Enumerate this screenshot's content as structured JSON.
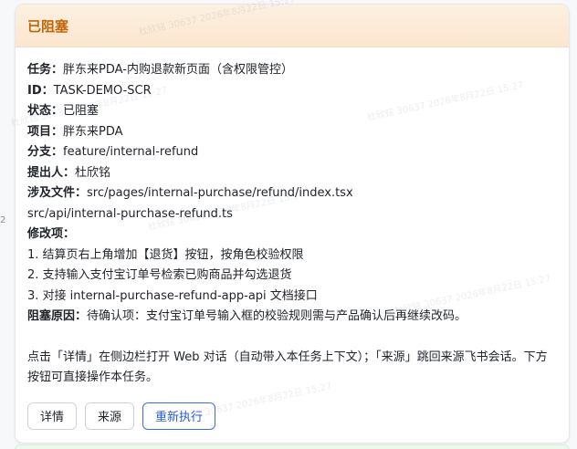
{
  "card": {
    "title": "已阻塞",
    "fields": {
      "task_label": "任务",
      "task_value": "胖东来PDA-内购退款新页面（含权限管控）",
      "id_label": "ID",
      "id_value": "TASK-DEMO-SCR",
      "status_label": "状态",
      "status_value": "已阻塞",
      "project_label": "项目",
      "project_value": "胖东来PDA",
      "branch_label": "分支",
      "branch_value": "feature/internal-refund",
      "submitter_label": "提出人",
      "submitter_value": "杜欣铭",
      "files_label": "涉及文件",
      "files": [
        "src/pages/internal-purchase/refund/index.tsx",
        "src/api/internal-purchase-refund.ts"
      ],
      "changes_label": "修改项",
      "changes": [
        "1. 结算页右上角增加【退货】按钮，按角色校验权限",
        "2. 支持输入支付宝订单号检索已购商品并勾选退货",
        "3. 对接 internal-purchase-refund-app-api 文档接口"
      ],
      "blocked_label": "阻塞原因",
      "blocked_value": "待确认项：支付宝订单号输入框的校验规则需与产品确认后再继续改码。"
    },
    "sep": "：",
    "note": "点击「详情」在侧边栏打开 Web 对话（自动带入本任务上下文）；「来源」跳回来源飞书会话。下方按钮可直接操作本任务。",
    "buttons": {
      "detail": "详情",
      "source": "来源",
      "rerun": "重新执行"
    }
  },
  "watermarks": [
    "杜欣铭 30637 2026年8月22日 15:27",
    "杜欣铭 30637 2026年8月22日 15:27",
    "杜欣铭 30637 2026年8月22日 15:27",
    "杜欣铭 30637 2026年8月22日 15:27",
    "杜欣铭 30637 2026年8月22日 15:27",
    "杜欣铭 30637 2026年8月22日 15:27"
  ],
  "edge_mark": "2",
  "colors": {
    "title": "#c0650a",
    "header_bg": "#fbe6cf",
    "primary": "#2b5fd0"
  }
}
